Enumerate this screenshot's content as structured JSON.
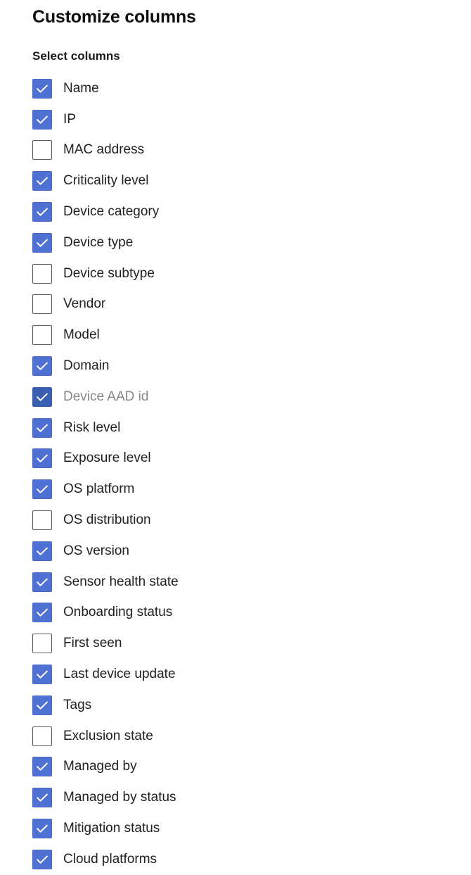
{
  "dialog": {
    "title": "Customize columns",
    "section_label": "Select columns"
  },
  "colors": {
    "checkbox_checked": "#5071d4",
    "checkbox_checked_disabled": "#3a5fb0",
    "checkbox_border": "#5a5a5a",
    "checkmark": "#ffffff",
    "label_text": "#212121",
    "label_text_disabled": "#8a8886",
    "title_text": "#0f0f0f",
    "background": "#ffffff"
  },
  "icons": {
    "checkmark": "checkmark-icon"
  },
  "columns": [
    {
      "label": "Name",
      "checked": true,
      "disabled": false
    },
    {
      "label": "IP",
      "checked": true,
      "disabled": false
    },
    {
      "label": "MAC address",
      "checked": false,
      "disabled": false
    },
    {
      "label": "Criticality level",
      "checked": true,
      "disabled": false
    },
    {
      "label": "Device category",
      "checked": true,
      "disabled": false
    },
    {
      "label": "Device type",
      "checked": true,
      "disabled": false
    },
    {
      "label": "Device subtype",
      "checked": false,
      "disabled": false
    },
    {
      "label": "Vendor",
      "checked": false,
      "disabled": false
    },
    {
      "label": "Model",
      "checked": false,
      "disabled": false
    },
    {
      "label": "Domain",
      "checked": true,
      "disabled": false
    },
    {
      "label": "Device AAD id",
      "checked": true,
      "disabled": true
    },
    {
      "label": "Risk level",
      "checked": true,
      "disabled": false
    },
    {
      "label": "Exposure level",
      "checked": true,
      "disabled": false
    },
    {
      "label": "OS platform",
      "checked": true,
      "disabled": false
    },
    {
      "label": "OS distribution",
      "checked": false,
      "disabled": false
    },
    {
      "label": "OS version",
      "checked": true,
      "disabled": false
    },
    {
      "label": "Sensor health state",
      "checked": true,
      "disabled": false
    },
    {
      "label": "Onboarding status",
      "checked": true,
      "disabled": false
    },
    {
      "label": "First seen",
      "checked": false,
      "disabled": false
    },
    {
      "label": "Last device update",
      "checked": true,
      "disabled": false
    },
    {
      "label": "Tags",
      "checked": true,
      "disabled": false
    },
    {
      "label": "Exclusion state",
      "checked": false,
      "disabled": false
    },
    {
      "label": "Managed by",
      "checked": true,
      "disabled": false
    },
    {
      "label": "Managed by status",
      "checked": true,
      "disabled": false
    },
    {
      "label": "Mitigation status",
      "checked": true,
      "disabled": false
    },
    {
      "label": "Cloud platforms",
      "checked": true,
      "disabled": false
    }
  ]
}
